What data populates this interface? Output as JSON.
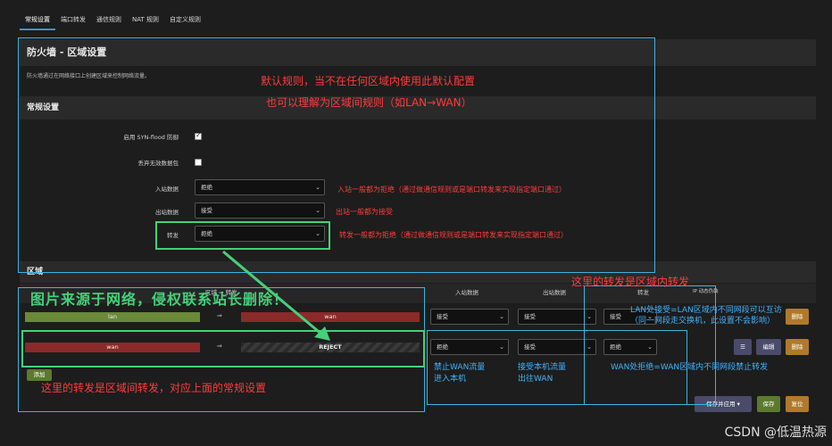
{
  "tabs": [
    "常规设置",
    "端口转发",
    "通信规则",
    "NAT 规则",
    "自定义规则"
  ],
  "section1": {
    "title": "防火墙 - 区域设置",
    "description": "防火墙通过在网络接口上创建区域来控制网络流量。"
  },
  "general": {
    "title": "常规设置",
    "syn_flood_label": "启用 SYN-flood 防御",
    "drop_invalid_label": "丢弃无效数据包",
    "input_label": "入站数据",
    "input_value": "拒绝",
    "output_label": "出站数据",
    "output_value": "接受",
    "forward_label": "转发",
    "forward_value": "拒绝"
  },
  "zones": {
    "title": "区域",
    "col_zone_forward": "区域 ⇒ 转发",
    "col_input": "入站数据",
    "col_output": "出站数据",
    "col_forward": "转发",
    "col_masq": "IP 动态伪装",
    "arrow": "⇒",
    "rows": [
      {
        "name": "lan",
        "forward": "wan",
        "input": "接受",
        "output": "接受",
        "forward_policy": "接受"
      },
      {
        "name": "wan",
        "forward": "REJECT",
        "input": "拒绝",
        "output": "接受",
        "forward_policy": "拒绝"
      }
    ],
    "add_label": "添加",
    "menu_label": "☰",
    "edit_label": "编辑",
    "delete_label": "删除"
  },
  "footer": {
    "save_apply_label": "保存并应用",
    "save_label": "保存",
    "reset_label": "复位"
  },
  "annotations": {
    "default_rule_1": "默认规则，当不在任何区域内使用此默认配置",
    "default_rule_2": "也可以理解为区域间规则（如LAN→WAN）",
    "input_note": "入站一般都为拒绝（通过做通信规则或是端口转发来实现指定端口通过）",
    "output_note": "出站一般都为接受",
    "forward_note": "转发一般都为拒绝（通过做通信规则或是端口转发来实现指定端口通过）",
    "zone_forward_note": "这里的转发是区域内转发",
    "lan_accept_note_1": "LAN处接受=LAN区域内不同网段可以互访",
    "lan_accept_note_2": "（同一网段走交换机，此设置不会影响）",
    "wan_reject_note": "WAN处拒绝=WAN区域内不同网段禁止转发",
    "block_wan_1": "禁止WAN流量",
    "block_wan_2": "进入本机",
    "accept_local_1": "接受本机流量",
    "accept_local_2": "出往WAN",
    "inter_zone_note": "这里的转发是区域间转发，对应上面的常规设置",
    "source_note": "图片来源于网络，侵权联系站长删除！"
  },
  "watermark": "CSDN @低温热源"
}
